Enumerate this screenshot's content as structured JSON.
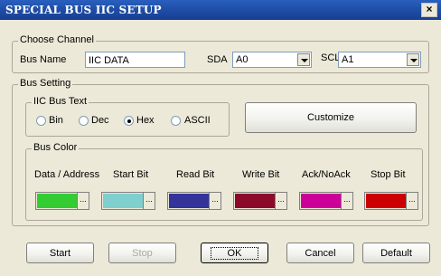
{
  "window": {
    "title": "SPECIAL BUS IIC SETUP",
    "close": "×"
  },
  "choose_channel": {
    "group_label": "Choose Channel",
    "bus_name_label": "Bus Name",
    "bus_name_value": "IIC DATA",
    "sda_label": "SDA",
    "sda_value": "A0",
    "scl_label": "SCL",
    "scl_value": "A1"
  },
  "bus_setting": {
    "group_label": "Bus Setting",
    "iic_text_label": "IIC Bus Text",
    "radios": [
      {
        "label": "Bin",
        "checked": false
      },
      {
        "label": "Dec",
        "checked": false
      },
      {
        "label": "Hex",
        "checked": true
      },
      {
        "label": "ASCII",
        "checked": false
      }
    ],
    "customize_label": "Customize",
    "color_group_label": "Bus Color",
    "colors": [
      {
        "label": "Data / Address",
        "color": "#33cc33"
      },
      {
        "label": "Start Bit",
        "color": "#7fcfcf"
      },
      {
        "label": "Read Bit",
        "color": "#333399"
      },
      {
        "label": "Write Bit",
        "color": "#8b0a2a"
      },
      {
        "label": "Ack/NoAck",
        "color": "#cc0099"
      },
      {
        "label": "Stop Bit",
        "color": "#cc0000"
      }
    ],
    "dots": "..."
  },
  "buttons": {
    "start": "Start",
    "stop": "Stop",
    "ok": "OK",
    "cancel": "Cancel",
    "default": "Default"
  }
}
